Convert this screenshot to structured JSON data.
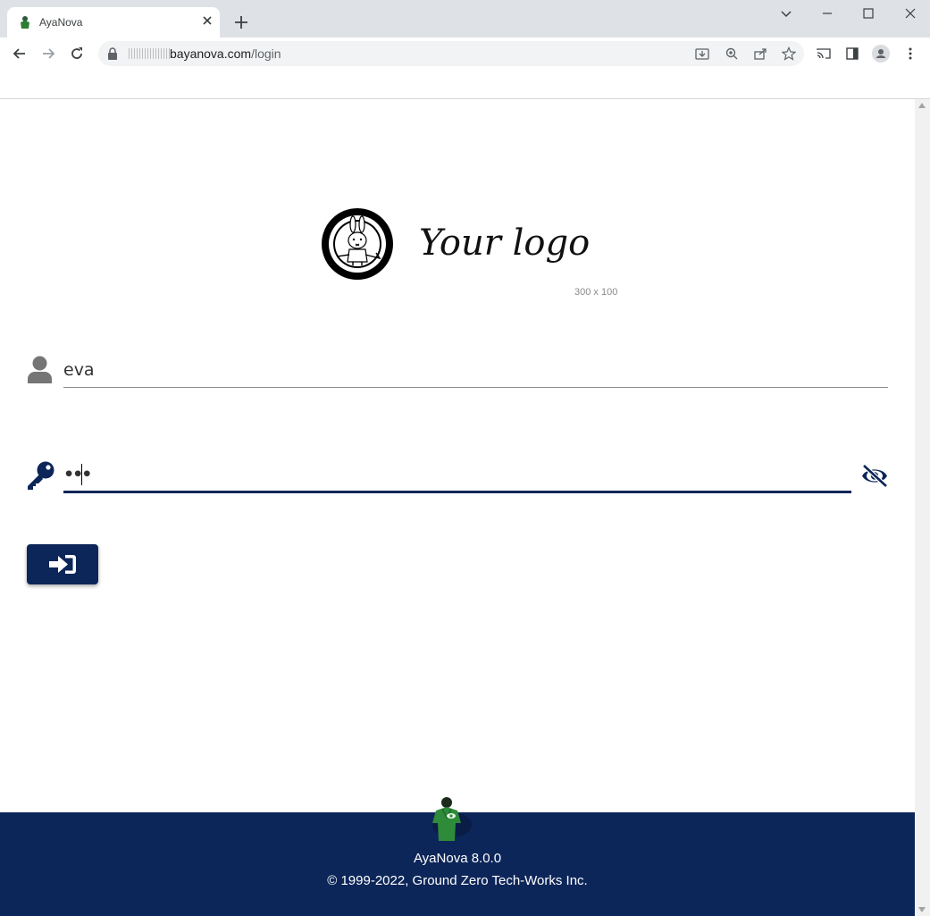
{
  "browser": {
    "tab_title": "AyaNova",
    "url_host": "bayanova.com",
    "url_path": "/login"
  },
  "login": {
    "username_value": "eva",
    "password_value": "•••",
    "logo_caption": "300 x 100",
    "logo_text": "Your logo"
  },
  "footer": {
    "version": "AyaNova 8.0.0",
    "copyright": "© 1999-2022, Ground Zero Tech-Works Inc."
  },
  "colors": {
    "brand_navy": "#0d2659",
    "chrome_bg": "#dee1e6"
  },
  "icons": {
    "user": "user-icon",
    "key": "key-icon",
    "eye_slash": "eye-slash-icon",
    "sign_in": "sign-in-icon"
  }
}
